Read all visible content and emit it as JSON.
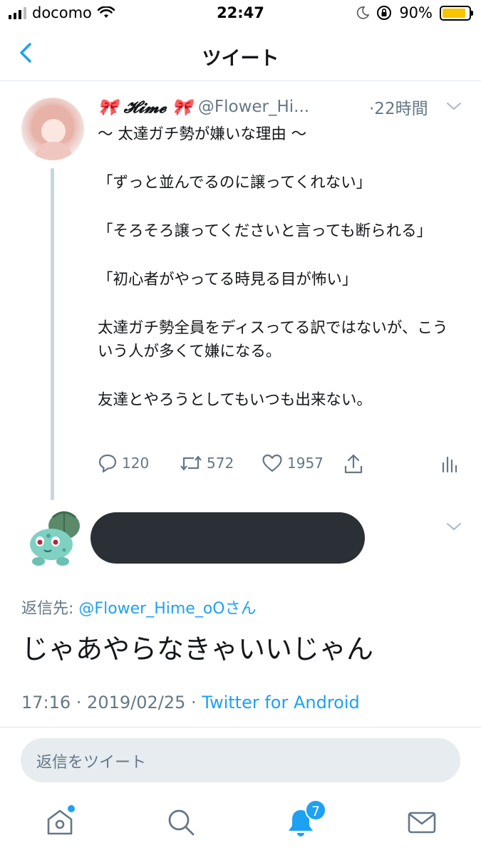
{
  "status_bar": {
    "carrier": "docomo",
    "time": "22:47",
    "battery": "90%",
    "battery_level": 0.9
  },
  "header": {
    "title": "ツイート"
  },
  "tweet1": {
    "display_name": "🎀 𝓗𝓲𝓶𝓮 🎀",
    "handle": "@Flower_Hi...",
    "time": "·22時間",
    "lines": [
      "〜 太達ガチ勢が嫌いな理由 〜",
      "",
      "「ずっと並んでるのに譲ってくれない」",
      "",
      "「そろそろ譲ってくださいと言っても断られる」",
      "",
      "「初心者がやってる時見る目が怖い」",
      "",
      "太達ガチ勢全員をディスってる訳ではないが、こういう人が多くて嫌になる。",
      "",
      "友達とやろうとしてもいつも出来ない。"
    ],
    "actions": {
      "replies": "120",
      "retweets": "572",
      "likes": "1957"
    }
  },
  "tweet2": {
    "reply_label": "返信先:",
    "reply_target": "@Flower_Hime_oOさん",
    "text": "じゃあやらなきゃいいじゃん",
    "timestamp": "17:16 · 2019/02/25 · ",
    "via": "Twitter for Android"
  },
  "reply_box": {
    "placeholder": "返信をツイート"
  },
  "tab_bar": {
    "notifications_count": "7"
  },
  "colors": {
    "accent": "#1da1f2",
    "secondary_text": "#657786",
    "thread_line": "#c9d6e1"
  }
}
